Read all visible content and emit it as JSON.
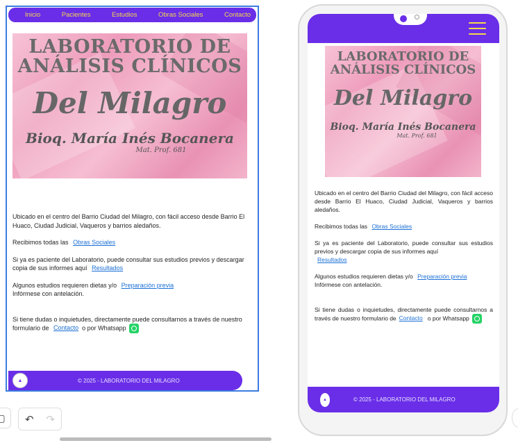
{
  "nav": {
    "items": [
      "Inicio",
      "Pacientes",
      "Estudios",
      "Obras Sociales",
      "Contacto"
    ]
  },
  "banner": {
    "line1": "LABORATORIO DE",
    "line2": "ANÁLISIS CLÍNICOS",
    "line3": "Del Milagro",
    "line4": "Bioq. María Inés Bocanera",
    "line5": "Mat. Prof. 681"
  },
  "content": {
    "intro": "Ubicado en el centro del Barrio Ciudad del Milagro, con fácil acceso desde Barrio El Huaco, Ciudad Judicial, Vaqueros y barrios aledaños.",
    "obras_text": "Recibimos todas las",
    "obras_link": "Obras Sociales",
    "resultados_text": "Si ya es paciente del Laboratorio, puede consultar sus estudios previos y descargar copia de sus informes aquí",
    "resultados_link": "Resultados",
    "prep_text": "Algunos estudios requieren dietas y/o",
    "prep_link": "Preparación previa",
    "prep_note": "Infórmese con antelación.",
    "contact_text": "Si tiene dudas o inquietudes, directamente puede consultarnos  a través de nuestro formulario de",
    "contact_link": "Contacto",
    "contact_tail": "o por Whatsapp"
  },
  "footer": {
    "copyright": "© 2025 - LABORATORIO DEL MILAGRO"
  },
  "colors": {
    "nav_bg": "#6a2ee8",
    "nav_text": "#f6d84a",
    "link": "#1a6fd6",
    "selection_border": "#3b7be0"
  }
}
